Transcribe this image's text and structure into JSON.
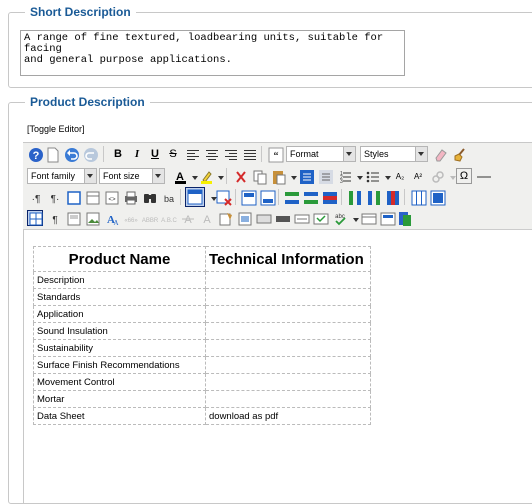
{
  "short_description": {
    "legend": "Short Description",
    "value": "A range of fine textured, loadbearing units, suitable for facing\nand general purpose applications."
  },
  "product_description": {
    "legend": "Product Description",
    "toggle_label": "[Toggle Editor]"
  },
  "toolbar": {
    "format_label": "Format",
    "styles_label": "Styles",
    "font_family_label": "Font family",
    "font_size_label": "Font size",
    "bold_label": "B",
    "italic_label": "I",
    "underline_label": "U",
    "strike_label": "S",
    "superscript_label": "A²",
    "subscript_label": "A₂",
    "omega_label": "Ω"
  },
  "table": {
    "headers": [
      "Product Name",
      "Technical Information"
    ],
    "rows": [
      [
        "Description",
        ""
      ],
      [
        "Standards",
        ""
      ],
      [
        "Application",
        ""
      ],
      [
        "Sound Insulation",
        ""
      ],
      [
        "Sustainability",
        ""
      ],
      [
        "Surface Finish Recommendations",
        ""
      ],
      [
        "Movement Control",
        ""
      ],
      [
        "Mortar",
        ""
      ],
      [
        "Data Sheet",
        "download as pdf"
      ]
    ]
  }
}
